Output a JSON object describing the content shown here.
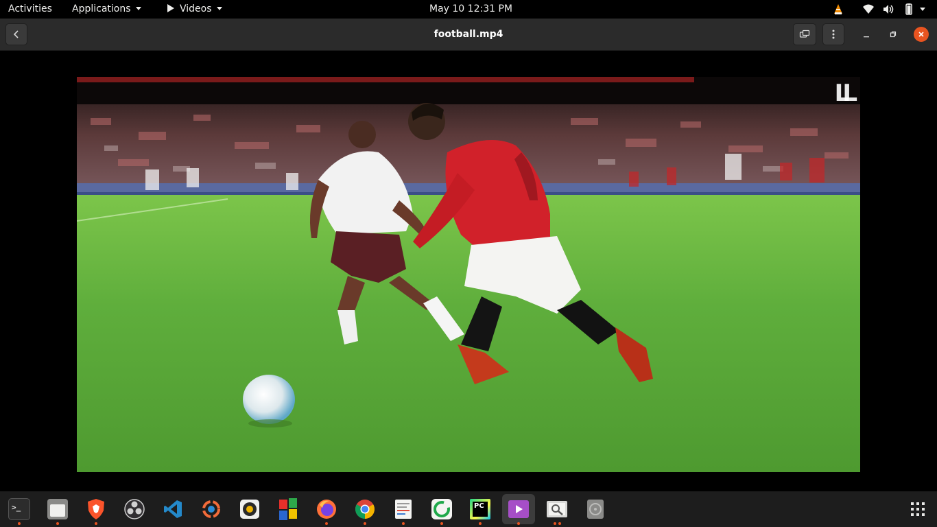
{
  "topbar": {
    "activities": "Activities",
    "applications": "Applications",
    "current_app": "Videos",
    "clock": "May 10  12:31 PM",
    "tray": [
      "vlc-icon",
      "wifi-icon",
      "volume-icon",
      "battery-icon",
      "power-menu-icon"
    ]
  },
  "headerbar": {
    "title": "football.mp4",
    "back_icon": "back-chevron-icon",
    "pip_icon": "picture-in-picture-icon",
    "menu_icon": "kebab-menu-icon",
    "window_controls": [
      "minimize",
      "restore",
      "close"
    ]
  },
  "video": {
    "watermark": "LL"
  },
  "dock": {
    "apps": [
      {
        "name": "terminal",
        "running": true
      },
      {
        "name": "files",
        "running": true
      },
      {
        "name": "brave",
        "running": true
      },
      {
        "name": "obs-studio",
        "running": false
      },
      {
        "name": "vscode",
        "running": false
      },
      {
        "name": "postman",
        "running": false
      },
      {
        "name": "rhythmbox",
        "running": false
      },
      {
        "name": "vlc-multicolor",
        "running": false
      },
      {
        "name": "firefox",
        "running": true
      },
      {
        "name": "chrome",
        "running": true
      },
      {
        "name": "text-editor",
        "running": true
      },
      {
        "name": "circle-app",
        "running": true
      },
      {
        "name": "pycharm",
        "running": true
      },
      {
        "name": "videos",
        "running": true,
        "active": true
      },
      {
        "name": "image-viewer",
        "running": true,
        "dots": 2
      },
      {
        "name": "disk-utility",
        "running": false
      }
    ],
    "show_apps_icon": "app-grid-icon",
    "pycharm_label": "PC"
  },
  "colors": {
    "accent": "#e95420",
    "pitch": "#5aa638",
    "header": "#2b2b2b"
  }
}
